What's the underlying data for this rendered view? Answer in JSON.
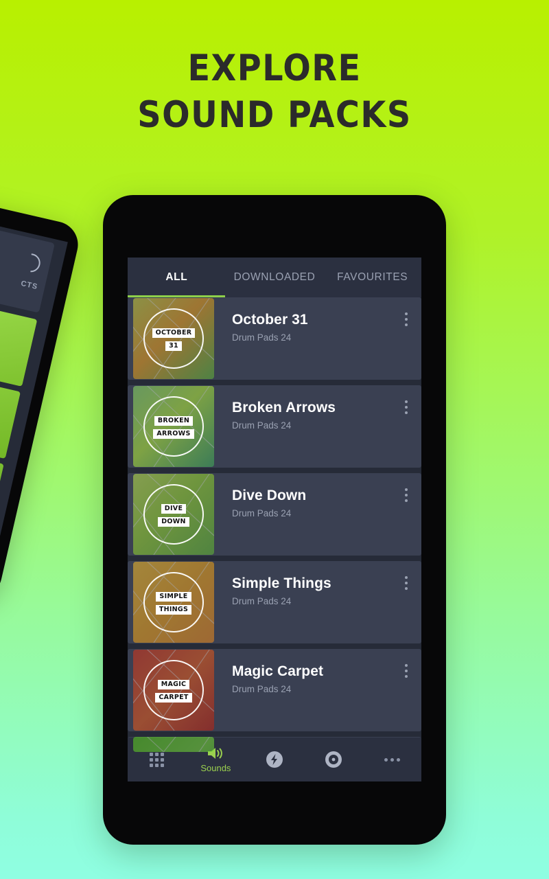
{
  "headline": {
    "line1": "EXPLORE",
    "line2": "SOUND PACKS",
    "color": "#2b2b2b"
  },
  "background": {
    "top_color": "#b8f000",
    "bottom_color": "#8ffee2"
  },
  "secondary_phone": {
    "card_label": "CTS",
    "icon": "rotate-icon"
  },
  "app": {
    "accent_color": "#8ed04a",
    "screen_bg": "#262b38",
    "card_bg": "#3a4052",
    "tabs": [
      {
        "label": "ALL",
        "active": true
      },
      {
        "label": "DOWNLOADED",
        "active": false
      },
      {
        "label": "FAVOURITES",
        "active": false
      }
    ],
    "packs": [
      {
        "title": "October 31",
        "subtitle": "Drum Pads 24",
        "art_line1": "OCTOBER",
        "art_line2": "31",
        "art_color_a": "#d9d23a",
        "art_color_b": "#f0a11a",
        "art_color_c": "#6fbf3a"
      },
      {
        "title": "Broken Arrows",
        "subtitle": "Drum Pads 24",
        "art_line1": "BROKEN",
        "art_line2": "ARROWS",
        "art_color_a": "#8fe06a",
        "art_color_b": "#b6f23a",
        "art_color_c": "#3fae5c"
      },
      {
        "title": "Dive Down",
        "subtitle": "Drum Pads 24",
        "art_line1": "DIVE",
        "art_line2": "DOWN",
        "art_color_a": "#b9e84a",
        "art_color_b": "#9ada2e",
        "art_color_c": "#6ec23a"
      },
      {
        "title": "Simple Things",
        "subtitle": "Drum Pads 24",
        "art_line1": "SIMPLE",
        "art_line2": "THINGS",
        "art_color_a": "#f7b321",
        "art_color_b": "#f5a516",
        "art_color_c": "#ef8e1c"
      },
      {
        "title": "Magic Carpet",
        "subtitle": "Drum Pads 24",
        "art_line1": "MAGIC",
        "art_line2": "CARPET",
        "art_color_a": "#e84a1a",
        "art_color_b": "#d32a12",
        "art_color_c": "#f06a22"
      },
      {
        "title": "",
        "subtitle": "",
        "art_line1": "",
        "art_line2": "",
        "art_color_a": "#5ed41e",
        "art_color_b": "#3dbb14",
        "art_color_c": "#7ae23a"
      }
    ],
    "bottom_nav": [
      {
        "icon": "grid-icon",
        "label": "",
        "active": false
      },
      {
        "icon": "speaker-icon",
        "label": "Sounds",
        "active": true
      },
      {
        "icon": "bolt-circle-icon",
        "label": "",
        "active": false
      },
      {
        "icon": "record-circle-icon",
        "label": "",
        "active": false
      },
      {
        "icon": "more-dots-icon",
        "label": "",
        "active": false
      }
    ]
  }
}
